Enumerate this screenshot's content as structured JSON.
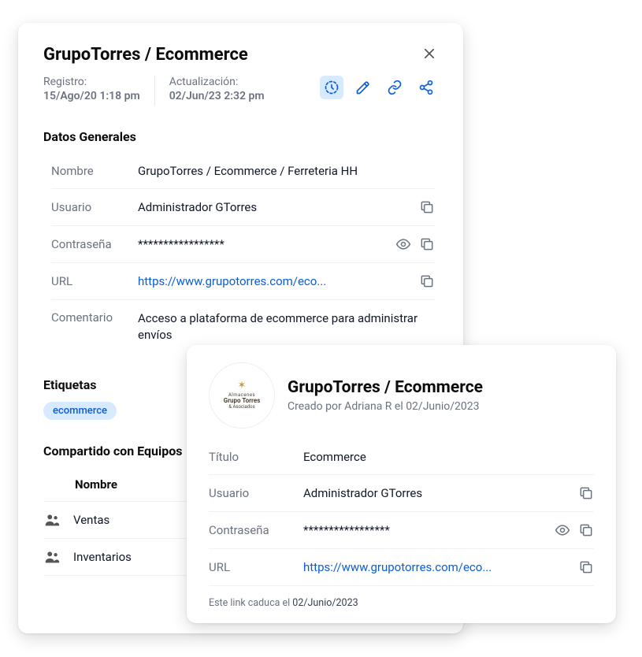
{
  "main": {
    "title": "GrupoTorres / Ecommerce",
    "registro_label": "Registro:",
    "registro_value": "15/Ago/20 1:18 pm",
    "actualizacion_label": "Actualización:",
    "actualizacion_value": "02/Jun/23 2:32 pm",
    "section_general": "Datos Generales",
    "fields": {
      "nombre_label": "Nombre",
      "nombre_value": "GrupoTorres / Ecommerce / Ferreteria HH",
      "usuario_label": "Usuario",
      "usuario_value": "Administrador GTorres",
      "contrasena_label": "Contraseña",
      "contrasena_value": "*****************",
      "url_label": "URL",
      "url_value": "https://www.grupotorres.com/eco...",
      "comentario_label": "Comentario",
      "comentario_value": "Acceso a plataforma de ecommerce para administrar envíos"
    },
    "section_tags": "Etiquetas",
    "tags": [
      "ecommerce"
    ],
    "section_teams": "Compartido con Equipos",
    "teams_header": "Nombre",
    "teams": [
      {
        "name": "Ventas"
      },
      {
        "name": "Inventarios"
      }
    ]
  },
  "overlay": {
    "logo": {
      "line1": "Almacenes",
      "line2": "Grupo Torres",
      "line3": "& Asociados"
    },
    "title": "GrupoTorres / Ecommerce",
    "subtitle": "Creado por Adriana R el 02/Junio/2023",
    "fields": {
      "titulo_label": "Título",
      "titulo_value": "Ecommerce",
      "usuario_label": "Usuario",
      "usuario_value": "Administrador GTorres",
      "contrasena_label": "Contraseña",
      "contrasena_value": "*****************",
      "url_label": "URL",
      "url_value": "https://www.grupotorres.com/eco..."
    },
    "expiry_prefix": "Este link caduca el ",
    "expiry_date": "02/Junio/2023"
  }
}
